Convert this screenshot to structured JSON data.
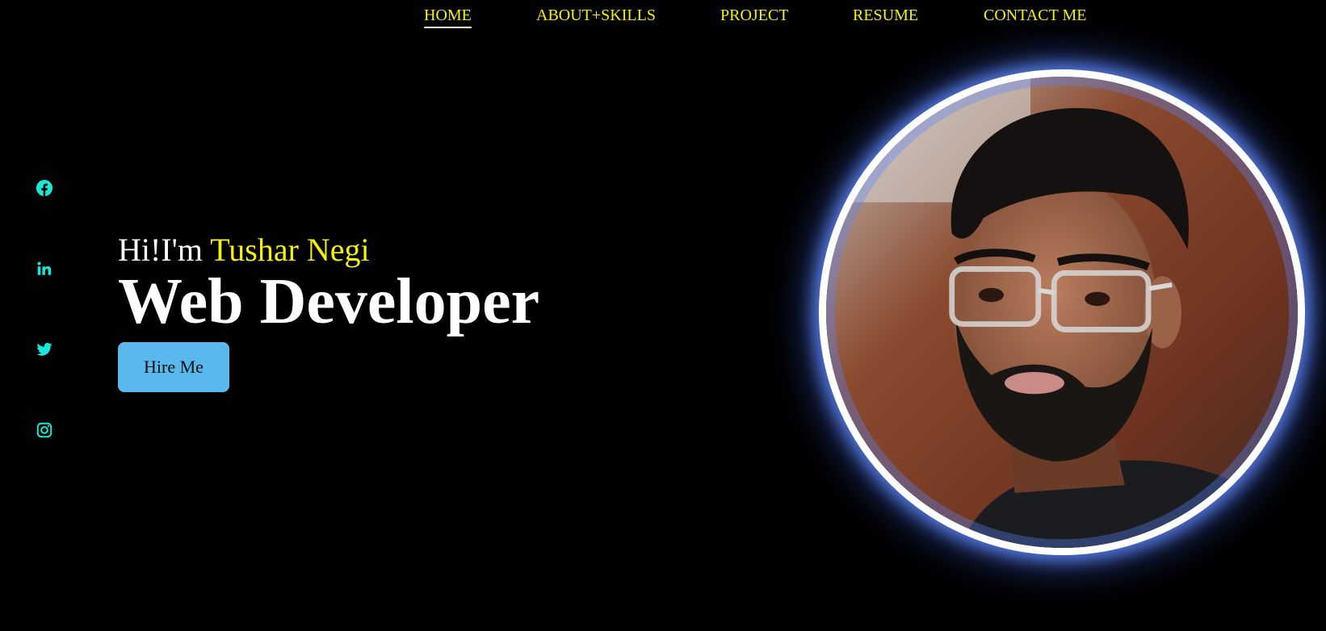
{
  "nav": {
    "items": [
      {
        "label": "HOME",
        "active": true
      },
      {
        "label": "ABOUT+SKILLS",
        "active": false
      },
      {
        "label": "PROJECT",
        "active": false
      },
      {
        "label": "RESUME",
        "active": false
      },
      {
        "label": "CONTACT ME",
        "active": false
      }
    ]
  },
  "social": {
    "icons": [
      "facebook-icon",
      "linkedin-icon",
      "twitter-icon",
      "instagram-icon"
    ],
    "color": "#18e8d8"
  },
  "hero": {
    "greeting_prefix": "Hi!I'm ",
    "name": "Tushar Negi",
    "role": "Web Developer",
    "cta_label": "Hire Me"
  },
  "colors": {
    "background": "#010101",
    "accent_yellow": "#f5f00a",
    "button_blue": "#5bb8ec",
    "glow_blue": "#6488ff"
  }
}
